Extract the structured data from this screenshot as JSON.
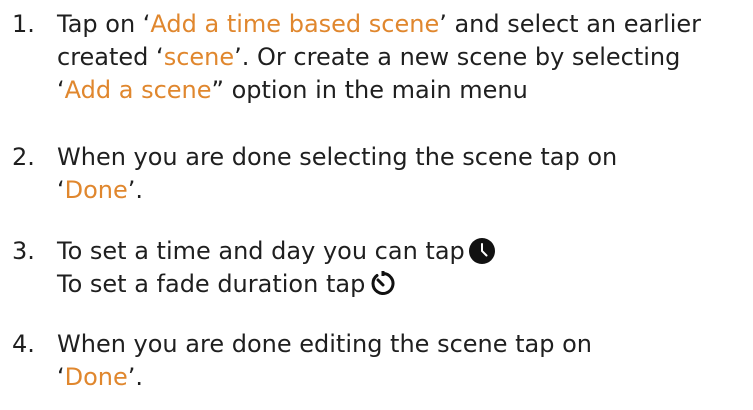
{
  "steps": [
    {
      "number": "1.",
      "lines": [
        [
          {
            "text": "Tap on ‘",
            "hl": false
          },
          {
            "text": "Add a time based scene",
            "hl": true
          },
          {
            "text": "’ and select an earlier",
            "hl": false
          }
        ],
        [
          {
            "text": "created ‘",
            "hl": false
          },
          {
            "text": "scene",
            "hl": true
          },
          {
            "text": "’. Or create a new scene by selecting",
            "hl": false
          }
        ],
        [
          {
            "text": "‘",
            "hl": false
          },
          {
            "text": "Add a scene",
            "hl": true
          },
          {
            "text": "” option in the main menu",
            "hl": false
          }
        ]
      ]
    },
    {
      "number": "2.",
      "lines": [
        [
          {
            "text": "When you are done selecting the scene tap on",
            "hl": false
          }
        ],
        [
          {
            "text": "‘",
            "hl": false
          },
          {
            "text": "Done",
            "hl": true
          },
          {
            "text": "’.",
            "hl": false
          }
        ]
      ]
    },
    {
      "number": "3.",
      "lines": [
        [
          {
            "text": "To set a time and day you can tap",
            "hl": false
          },
          {
            "icon": "clock-icon"
          }
        ],
        [
          {
            "text": "To set a fade duration tap",
            "hl": false
          },
          {
            "icon": "timer-icon"
          }
        ]
      ]
    },
    {
      "number": "4.",
      "lines": [
        [
          {
            "text": "When you are done editing the scene tap on",
            "hl": false
          }
        ],
        [
          {
            "text": "‘",
            "hl": false
          },
          {
            "text": "Done",
            "hl": true
          },
          {
            "text": "’.",
            "hl": false
          }
        ]
      ]
    }
  ],
  "colors": {
    "highlight": "#e0872e",
    "text": "#1f1f1f"
  }
}
